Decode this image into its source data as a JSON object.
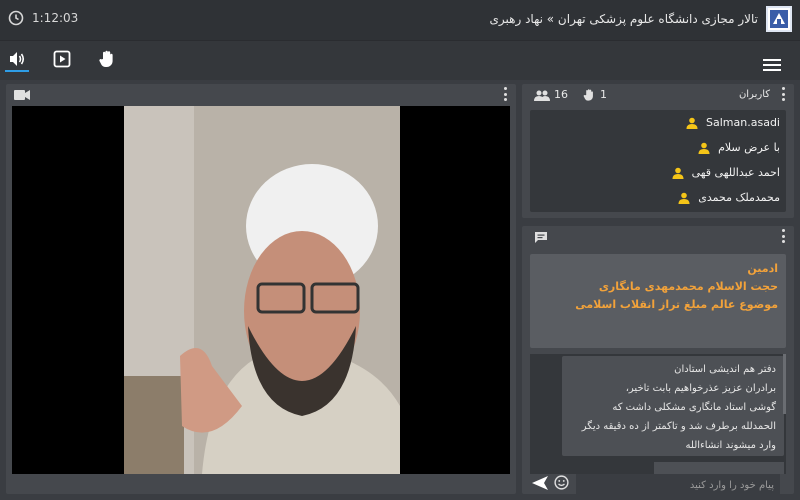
{
  "header": {
    "time": "1:12:03",
    "title": "تالار مجازی دانشگاه علوم پزشکی تهران » نهاد رهبری"
  },
  "toolbar": {
    "audio_icon": "speaker-icon",
    "play_icon": "play-icon",
    "hand_icon": "raise-hand-icon",
    "menu_icon": "hamburger-menu-icon",
    "accent": "#2e9de6"
  },
  "video": {
    "camera_icon": "video-camera-icon"
  },
  "users": {
    "title": "کاربران",
    "count": "16",
    "hands_count": "1",
    "icon_color": "#f5c518",
    "items": [
      {
        "label": "Salman.asadi"
      },
      {
        "label": "با عرض سلام"
      },
      {
        "label": "احمد عبداللهی قهی"
      },
      {
        "label": "محمدملک محمدی"
      }
    ]
  },
  "chat": {
    "admin_lines": [
      "ادمین",
      "حجت الاسلام محمدمهدی مانگاری",
      "موضوع  عالم مبلغ تراز انقلاب اسلامی"
    ],
    "message_lines": [
      "دفتر هم اندیشی استادان",
      "برادران عزیز  عذرخواهیم بابت تاخیر،",
      "گوشی استاد مانگاری مشکلی داشت که",
      "الحمدلله برطرف شد و تاکمتر از ده دقیقه دیگر",
      "وارد میشوند انشاءالله"
    ],
    "input_placeholder": "پیام خود را وارد کنید",
    "accent": "#f2a23a"
  }
}
